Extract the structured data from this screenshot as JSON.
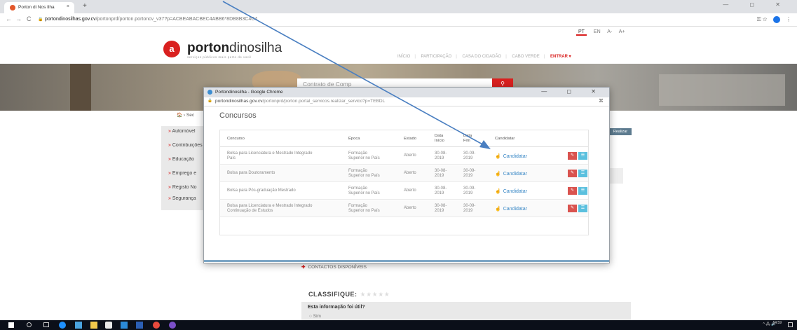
{
  "browser": {
    "tab_title": "Porton di Nos Ilha",
    "tab_close": "×",
    "new_tab": "+",
    "window_controls": "—  ◻  ✕",
    "url_host": "portondinosilhas.gov.cv",
    "url_path": "/portonprd/porton.portoncv_v37?p=ACBEABACBEC4ABB6*8DB8B3C4C4",
    "nav_back": "←",
    "nav_forward": "→",
    "nav_reload": "C",
    "lock": "🔒",
    "right_icons": "⚿  ☆",
    "more": "⋮"
  },
  "page": {
    "lang_pt": "PT",
    "lang_en": "EN",
    "font_minus": "A-",
    "font_plus": "A+",
    "logo_bold": "porton",
    "logo_light": "dinosilha",
    "logo_tag": "serviços públicos mais perto de você",
    "nav": [
      "INÍCIO",
      "PARTICIPAÇÃO",
      "CASA DO CIDADÃO",
      "CABO VERDE"
    ],
    "nav_entrar": "ENTRAR ▾",
    "search_value": "Contrato de Comp",
    "breadcrumb": "🏠  ›  Sec",
    "sidebar": [
      "Automóvel",
      "Contribuições",
      "Educação",
      "Emprego e",
      "Registo No",
      "Segurança"
    ],
    "realizar": "Realizar",
    "contactos": "CONTACTOS DISPONÍVEIS",
    "classifique": "CLASSIFIQUE:",
    "stars": "★★★★★",
    "feedback_q": "Esta informação foi útil?",
    "feedback_opt": "○ Sim"
  },
  "popup": {
    "title": "Portondinosilha - Google Chrome",
    "controls": "—  ◻  ✕",
    "url_host": "portondinosilhas.gov.cv",
    "url_path": "/portonprd/porton.portal_servicos.realizar_servico?p=TEBDL",
    "heading": "Concursos",
    "columns": {
      "concurso": "Concurso",
      "epoca": "Época",
      "estado": "Estado",
      "inicio": "Data\nInício",
      "fim": "Data\nFim",
      "candidatar": "Candidatar"
    },
    "rows": [
      {
        "concurso": "Bolsa para Licenciatura e Mestrado Integrado\nPaís",
        "epoca": "Formação\nSuperior no País",
        "estado": "Aberto",
        "inicio": "30-08-\n2019",
        "fim": "30-09-\n2019",
        "action": "Candidatar"
      },
      {
        "concurso": "Bolsa para Doutoramento",
        "epoca": "Formação\nSuperior no País",
        "estado": "Aberto",
        "inicio": "30-08-\n2019",
        "fim": "30-09-\n2019",
        "action": "Candidatar"
      },
      {
        "concurso": "Bolsa para Pós-graduação Mestrado",
        "epoca": "Formação\nSuperior no País",
        "estado": "Aberto",
        "inicio": "30-08-\n2019",
        "fim": "30-09-\n2019",
        "action": "Candidatar"
      },
      {
        "concurso": "Bolsa para Licenciatura e Mestrado Integrado\nContinuação de Estudos",
        "epoca": "Formação\nSuperior no País",
        "estado": "Aberto",
        "inicio": "30-08-\n2019",
        "fim": "30-09-\n2019",
        "action": "Candidatar"
      }
    ]
  },
  "taskbar": {
    "tray": "^ 🖧 🔊",
    "time": "14:59"
  },
  "colors": {
    "brand_red": "#d9201f",
    "link_blue": "#3b89c6",
    "arrow": "#4a7fc1"
  }
}
